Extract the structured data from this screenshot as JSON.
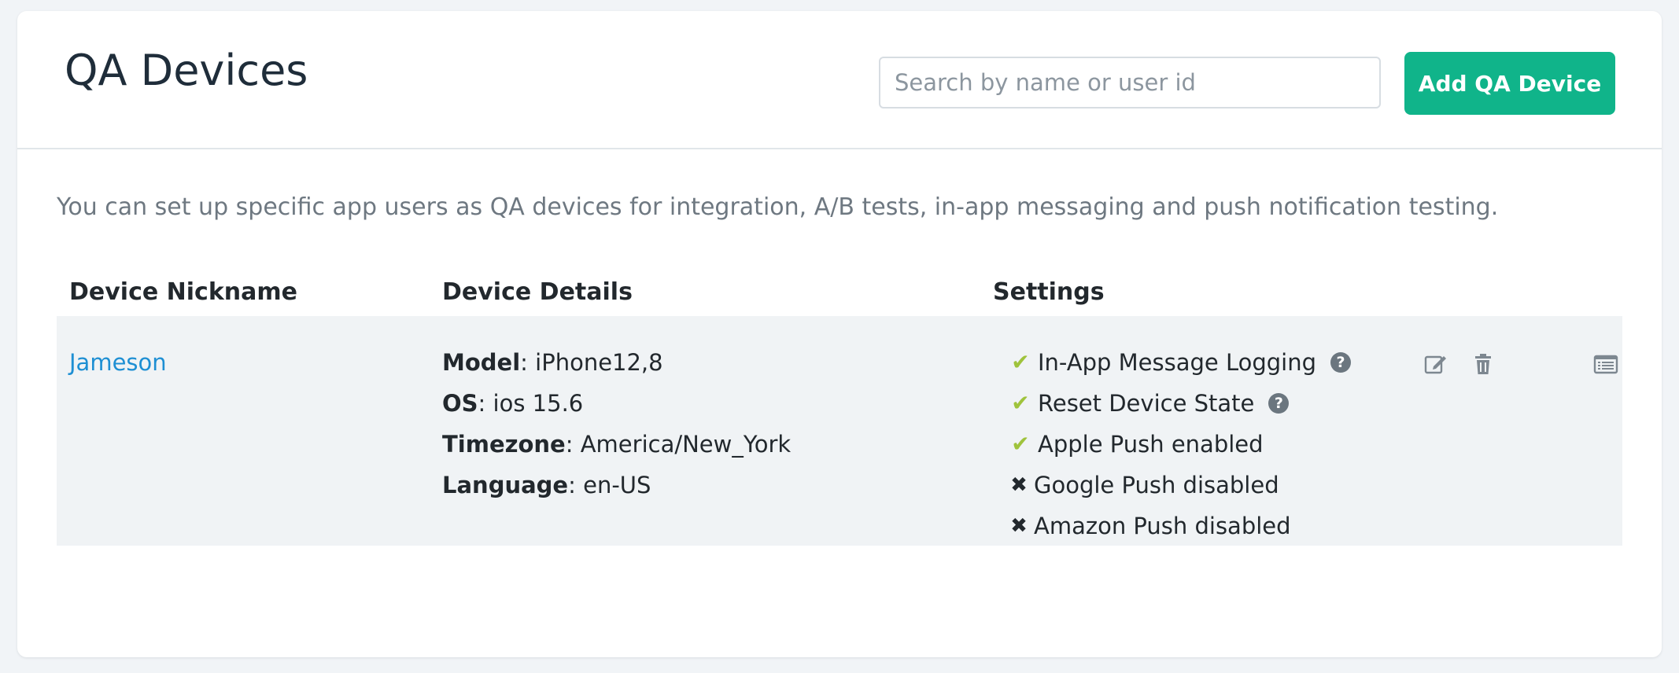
{
  "page": {
    "title": "QA Devices",
    "description": "You can set up specific app users as QA devices for integration, A/B tests, in-app messaging and push notification testing."
  },
  "search": {
    "placeholder": "Search by name or user id",
    "value": ""
  },
  "toolbar": {
    "add_label": "Add QA Device"
  },
  "table": {
    "columns": [
      "Device Nickname",
      "Device Details",
      "Settings"
    ],
    "rows": [
      {
        "nickname": "Jameson",
        "details": [
          {
            "key": "Model",
            "value": ": iPhone12,8"
          },
          {
            "key": "OS",
            "value": ": ios 15.6"
          },
          {
            "key": "Timezone",
            "value": ": America/New_York"
          },
          {
            "key": "Language",
            "value": ": en-US"
          }
        ],
        "settings": [
          {
            "label": "In-App Message Logging",
            "enabled": true,
            "has_help": true
          },
          {
            "label": "Reset Device State",
            "enabled": true,
            "has_help": true
          },
          {
            "label": "Apple Push enabled",
            "enabled": true,
            "has_help": false
          },
          {
            "label": "Google Push disabled",
            "enabled": false,
            "has_help": false
          },
          {
            "label": "Amazon Push disabled",
            "enabled": false,
            "has_help": false
          }
        ],
        "actions": [
          "edit-icon",
          "trash-icon",
          "details-list-icon"
        ]
      }
    ]
  },
  "icons": {
    "check": "✔",
    "cross": "✖",
    "help": "?"
  },
  "colors": {
    "accent": "#10b48a",
    "link": "#1e8fd3",
    "check": "#9fc33c",
    "row_background": "#f0f3f5",
    "page_background": "#f1f4f7"
  }
}
